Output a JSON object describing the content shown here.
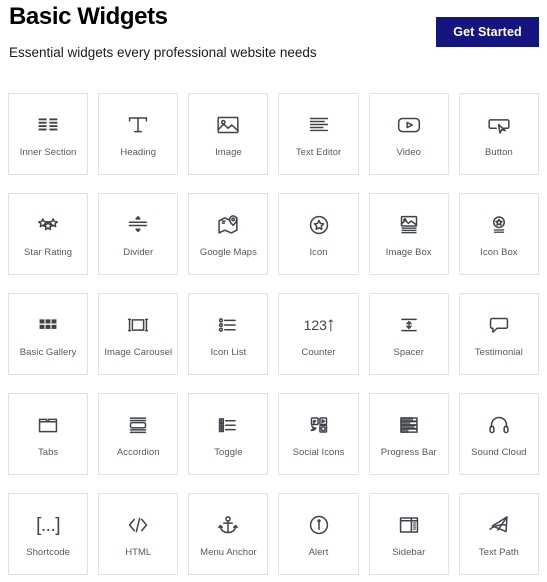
{
  "header": {
    "title": "Basic Widgets",
    "subtitle": "Essential widgets every professional website needs",
    "cta_label": "Get Started",
    "cta_color": "#15157f"
  },
  "theme": {
    "card_border": "#e2e2e4",
    "label_color": "#54595f",
    "icon_color": "#3f444b",
    "background": "#ffffff"
  },
  "grid": {
    "columns": 6,
    "rows": 5,
    "items": [
      {
        "label": "Inner Section",
        "icon": "inner-section-icon"
      },
      {
        "label": "Heading",
        "icon": "heading-icon"
      },
      {
        "label": "Image",
        "icon": "image-icon"
      },
      {
        "label": "Text Editor",
        "icon": "text-editor-icon"
      },
      {
        "label": "Video",
        "icon": "video-icon"
      },
      {
        "label": "Button",
        "icon": "button-icon"
      },
      {
        "label": "Star Rating",
        "icon": "star-rating-icon"
      },
      {
        "label": "Divider",
        "icon": "divider-icon"
      },
      {
        "label": "Google Maps",
        "icon": "google-maps-icon"
      },
      {
        "label": "Icon",
        "icon": "icon-star-circle-icon"
      },
      {
        "label": "Image Box",
        "icon": "image-box-icon"
      },
      {
        "label": "Icon Box",
        "icon": "icon-box-icon"
      },
      {
        "label": "Basic Gallery",
        "icon": "basic-gallery-icon"
      },
      {
        "label": "Image Carousel",
        "icon": "image-carousel-icon"
      },
      {
        "label": "Icon List",
        "icon": "icon-list-icon"
      },
      {
        "label": "Counter",
        "icon": "counter-icon",
        "glyph": "123"
      },
      {
        "label": "Spacer",
        "icon": "spacer-icon"
      },
      {
        "label": "Testimonial",
        "icon": "testimonial-icon"
      },
      {
        "label": "Tabs",
        "icon": "tabs-icon"
      },
      {
        "label": "Accordion",
        "icon": "accordion-icon"
      },
      {
        "label": "Toggle",
        "icon": "toggle-icon"
      },
      {
        "label": "Social Icons",
        "icon": "social-icons-icon"
      },
      {
        "label": "Progress Bar",
        "icon": "progress-bar-icon"
      },
      {
        "label": "Sound Cloud",
        "icon": "sound-cloud-icon"
      },
      {
        "label": "Shortcode",
        "icon": "shortcode-icon",
        "glyph": "[...]"
      },
      {
        "label": "HTML",
        "icon": "html-icon"
      },
      {
        "label": "Menu Anchor",
        "icon": "menu-anchor-icon"
      },
      {
        "label": "Alert",
        "icon": "alert-icon"
      },
      {
        "label": "Sidebar",
        "icon": "sidebar-icon"
      },
      {
        "label": "Text Path",
        "icon": "text-path-icon"
      }
    ]
  }
}
